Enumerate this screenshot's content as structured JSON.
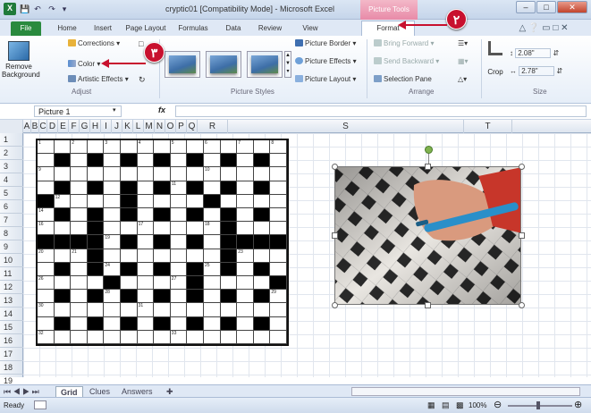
{
  "window": {
    "title": "cryptic01 [Compatibility Mode] - Microsoft Excel",
    "context_tab": "Picture Tools"
  },
  "tabs": [
    "File",
    "Home",
    "Insert",
    "Page Layout",
    "Formulas",
    "Data",
    "Review",
    "View",
    "Format"
  ],
  "ribbon": {
    "remove_background": "Remove\nBackground",
    "adjust": {
      "corrections": "Corrections ▾",
      "color": "Color ▾",
      "artistic": "Artistic Effects ▾",
      "label": "Adjust"
    },
    "styles": {
      "border": "Picture Border ▾",
      "effects": "Picture Effects ▾",
      "layout": "Picture Layout ▾",
      "label": "Picture Styles"
    },
    "arrange": {
      "bring": "Bring Forward ▾",
      "send": "Send Backward ▾",
      "selection": "Selection Pane",
      "label": "Arrange"
    },
    "size": {
      "crop": "Crop",
      "height": "2.08\"",
      "width": "2.78\"",
      "label": "Size"
    }
  },
  "callouts": [
    "٢",
    "٣"
  ],
  "formula_bar": {
    "name_box": "Picture 1",
    "fx": "fx"
  },
  "columns": [
    "A",
    "B",
    "C",
    "D",
    "E",
    "F",
    "G",
    "H",
    "I",
    "J",
    "K",
    "L",
    "M",
    "N",
    "O",
    "P",
    "Q",
    "R",
    "S",
    "T"
  ],
  "rows": [
    "1",
    "2",
    "3",
    "4",
    "5",
    "6",
    "7",
    "8",
    "9",
    "10",
    "11",
    "12",
    "13",
    "14",
    "15",
    "16",
    "17",
    "18",
    "19"
  ],
  "crossword": {
    "rows": [
      "...............",
      ".#.#.#.#.#.#.#.",
      "...............",
      ".#.#.#.#.#.#.#.",
      "#....#....#....",
      ".#.#.#.#.#.#.#.",
      "...#.......#...",
      "####.#.#.#.####",
      "...#.......#...",
      ".#.#.#.#.#.#.#.",
      "....#....#....#",
      ".#.#.#.#.#.#.#.",
      "...............",
      ".#.#.#.#.#.#.#.",
      "..............."
    ],
    "numbers": [
      [
        "0",
        "0",
        "1"
      ],
      [
        "0",
        "2",
        "2"
      ],
      [
        "0",
        "4",
        "3"
      ],
      [
        "0",
        "6",
        "4"
      ],
      [
        "0",
        "8",
        "5"
      ],
      [
        "0",
        "10",
        "6"
      ],
      [
        "0",
        "12",
        "7"
      ],
      [
        "0",
        "14",
        "8"
      ],
      [
        "2",
        "0",
        "9"
      ],
      [
        "2",
        "10",
        "10"
      ],
      [
        "3",
        "8",
        "11"
      ],
      [
        "4",
        "1",
        "12"
      ],
      [
        "4",
        "10",
        "13"
      ],
      [
        "5",
        "0",
        "14"
      ],
      [
        "5",
        "7",
        "15"
      ],
      [
        "6",
        "0",
        "16"
      ],
      [
        "6",
        "6",
        "17"
      ],
      [
        "6",
        "10",
        "18"
      ],
      [
        "7",
        "4",
        "19"
      ],
      [
        "8",
        "0",
        "20"
      ],
      [
        "8",
        "2",
        "21"
      ],
      [
        "8",
        "11",
        "22"
      ],
      [
        "8",
        "12",
        "23"
      ],
      [
        "9",
        "4",
        "24"
      ],
      [
        "9",
        "10",
        "25"
      ],
      [
        "10",
        "0",
        "26"
      ],
      [
        "10",
        "8",
        "27"
      ],
      [
        "11",
        "4",
        "28"
      ],
      [
        "11",
        "14",
        "29"
      ],
      [
        "12",
        "0",
        "30"
      ],
      [
        "12",
        "6",
        "31"
      ],
      [
        "14",
        "0",
        "32"
      ],
      [
        "14",
        "8",
        "33"
      ]
    ]
  },
  "sheets": [
    "Grid",
    "Clues",
    "Answers"
  ],
  "status": {
    "ready": "Ready",
    "zoom": "100%"
  }
}
